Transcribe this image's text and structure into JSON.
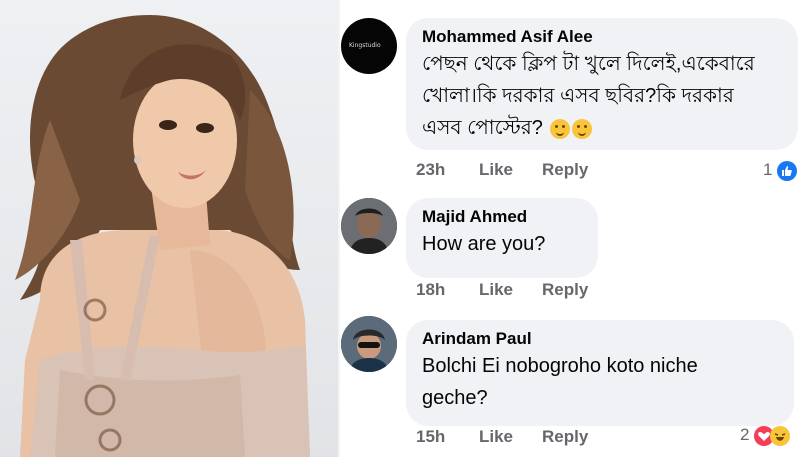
{
  "comments": [
    {
      "author": "Mohammed Asif Alee",
      "avatar_label": "Kingstudio",
      "lines": [
        "পেছন থেকে ক্লিপ টা খুলে দিলেই,একেবারে",
        "খোলা।কি দরকার এসব ছবির?কি দরকার",
        "এসব পোস্টের?"
      ],
      "emoji_count": 2,
      "time": "23h",
      "like_label": "Like",
      "reply_label": "Reply",
      "reaction_count": "1",
      "reaction_icon": "like-icon"
    },
    {
      "author": "Majid Ahmed",
      "lines": [
        "How are you?"
      ],
      "time": "18h",
      "like_label": "Like",
      "reply_label": "Reply"
    },
    {
      "author": "Arindam Paul",
      "lines": [
        "Bolchi Ei nobogroho koto niche",
        "geche?"
      ],
      "time": "15h",
      "like_label": "Like",
      "reply_label": "Reply",
      "reaction_count": "2",
      "reaction_icons": [
        "love-icon",
        "haha-icon"
      ]
    }
  ],
  "colors": {
    "bubble": "#f0f2f5",
    "meta": "#65676b",
    "like_blue": "#1877f2",
    "love_red": "#f33e58"
  }
}
